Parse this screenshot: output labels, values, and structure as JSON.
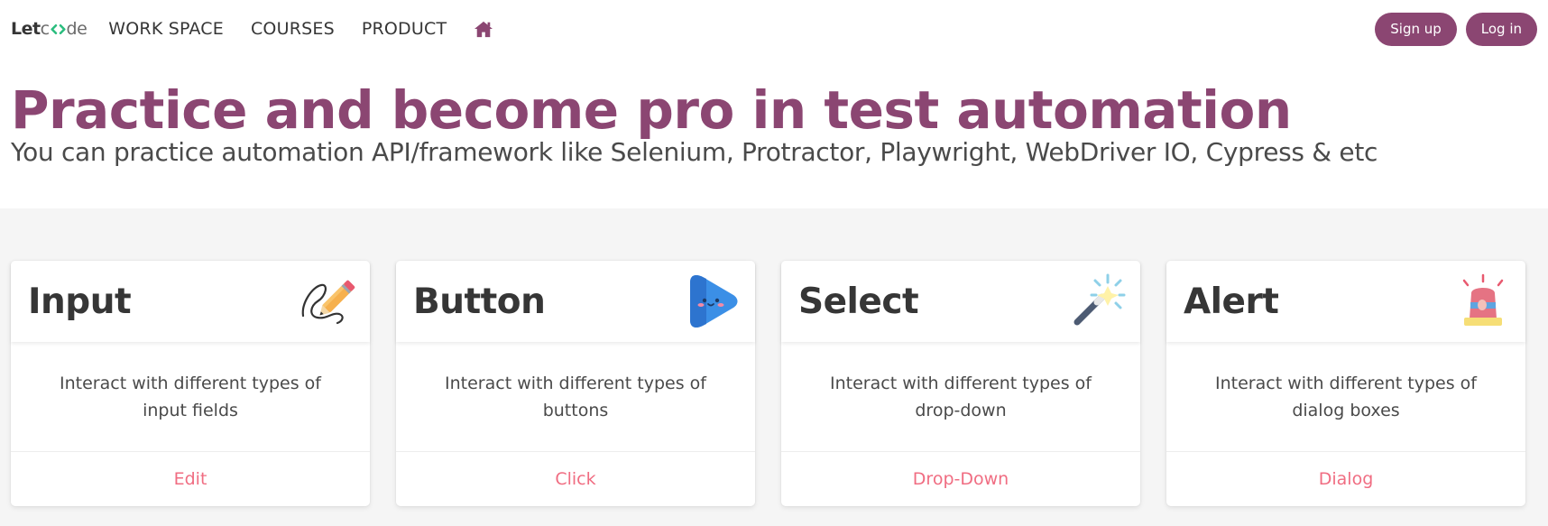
{
  "header": {
    "logo": {
      "part1": "Let",
      "part2": "de",
      "mark_icon": "code-brackets-icon"
    },
    "nav": [
      {
        "label": "WORK SPACE"
      },
      {
        "label": "COURSES"
      },
      {
        "label": "PRODUCT"
      }
    ],
    "home_icon": "home-icon",
    "signup_label": "Sign up",
    "login_label": "Log in"
  },
  "hero": {
    "title": "Practice and become pro in test automation",
    "subtitle": "You can practice automation API/framework like Selenium, Protractor, Playwright, WebDriver IO, Cypress & etc"
  },
  "cards": [
    {
      "title": "Input",
      "icon": "pencil-icon",
      "description": "Interact with different types of input fields",
      "link": "Edit"
    },
    {
      "title": "Button",
      "icon": "play-button-icon",
      "description": "Interact with different types of buttons",
      "link": "Click"
    },
    {
      "title": "Select",
      "icon": "magic-wand-icon",
      "description": "Interact with different types of drop-down",
      "link": "Drop-Down"
    },
    {
      "title": "Alert",
      "icon": "siren-icon",
      "description": "Interact with different types of dialog boxes",
      "link": "Dialog"
    }
  ],
  "colors": {
    "brand": "#8b4672",
    "link": "#f06d82",
    "text": "#363636",
    "page_bg": "#f5f5f5"
  }
}
